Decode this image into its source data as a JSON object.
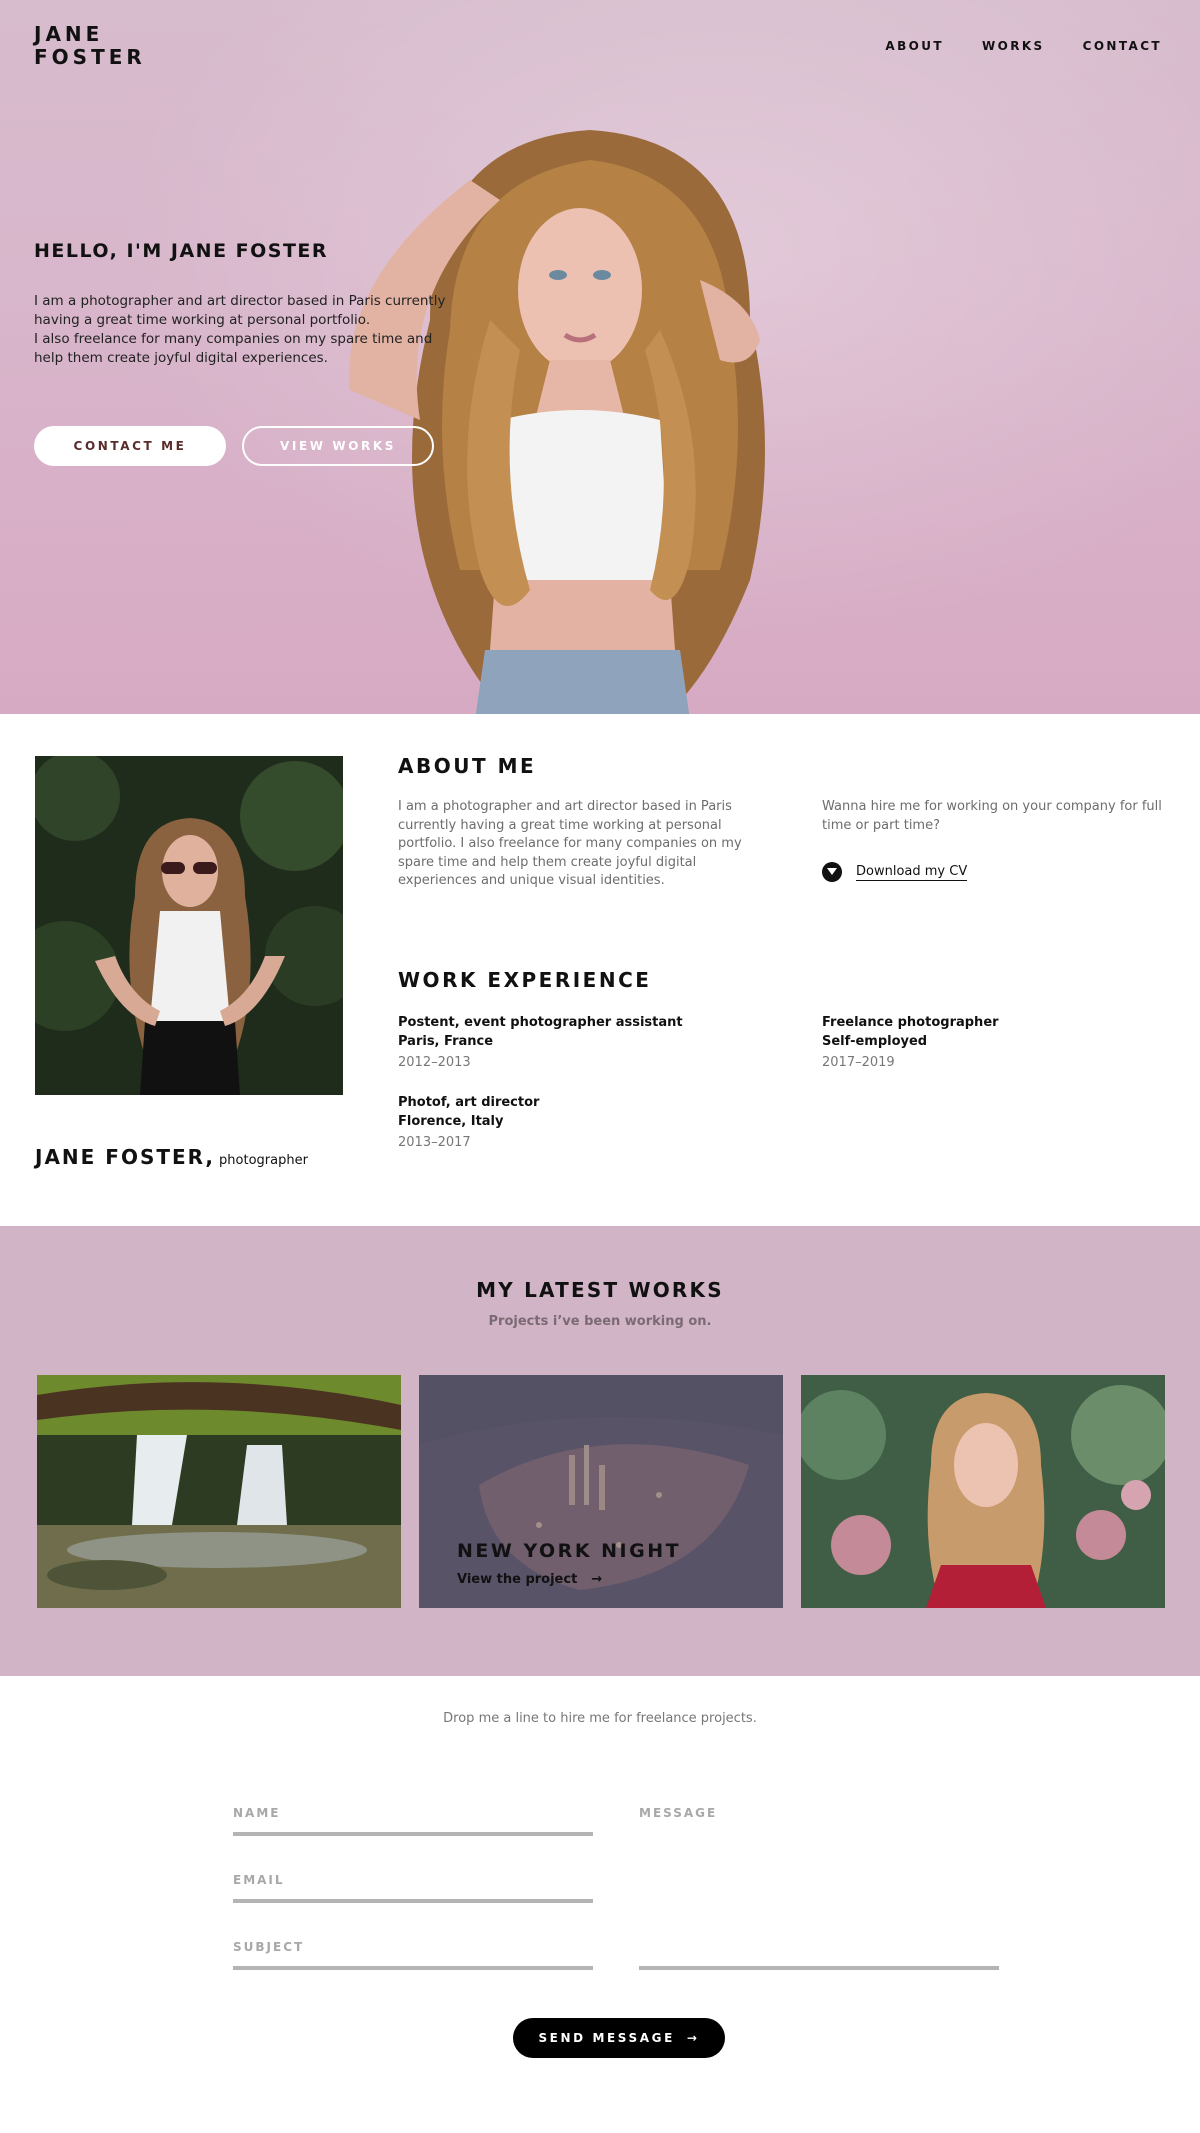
{
  "header": {
    "logo_line1": "JANE",
    "logo_line2": "FOSTER",
    "nav": [
      "ABOUT",
      "WORKS",
      "CONTACT"
    ]
  },
  "hero": {
    "title": "HELLO, I'M JANE FOSTER",
    "description_lines": [
      "I am a photographer and art director based in Paris currently",
      "having a great time working at personal portfolio.",
      "I also freelance for many companies on my spare time and",
      "help them create joyful digital experiences."
    ],
    "contact_button": "CONTACT ME",
    "works_button": "VIEW WORKS"
  },
  "about": {
    "name": "JANE FOSTER,",
    "role": "photographer",
    "title": "ABOUT ME",
    "body": "I am a photographer and art director based in Paris currently having a great time working at personal portfolio. I also freelance for many companies on my spare time and help them create joyful digital experiences and unique visual identities.",
    "hire_text": "Wanna hire me for working on your company for full time or part time?",
    "cv_link": "Download my CV"
  },
  "experience": {
    "title": "WORK EXPERIENCE",
    "jobs": [
      {
        "role": "Postent, event photographer assistant",
        "place": "Paris, France",
        "years": "2012–2013"
      },
      {
        "role": "Freelance photographer",
        "place": "Self-employed",
        "years": "2017–2019"
      },
      {
        "role": "Photof, art director",
        "place": "Florence, Italy",
        "years": "2013–2017"
      }
    ]
  },
  "works": {
    "title": "MY LATEST WORKS",
    "subtitle": "Projects i’ve been working on.",
    "featured_title": "NEW YORK NIGHT",
    "featured_link": "View the project"
  },
  "contact": {
    "intro": "Drop me a line to hire me for freelance projects.",
    "name_label": "NAME",
    "email_label": "EMAIL",
    "subject_label": "SUBJECT",
    "message_label": "MESSAGE",
    "send_button": "SEND MESSAGE"
  },
  "colors": {
    "hero_bg": "#d8b6cb",
    "works_bg": "#d1b5c6",
    "button_dark": "#000000",
    "contact_button_text": "#5a2c2c"
  }
}
